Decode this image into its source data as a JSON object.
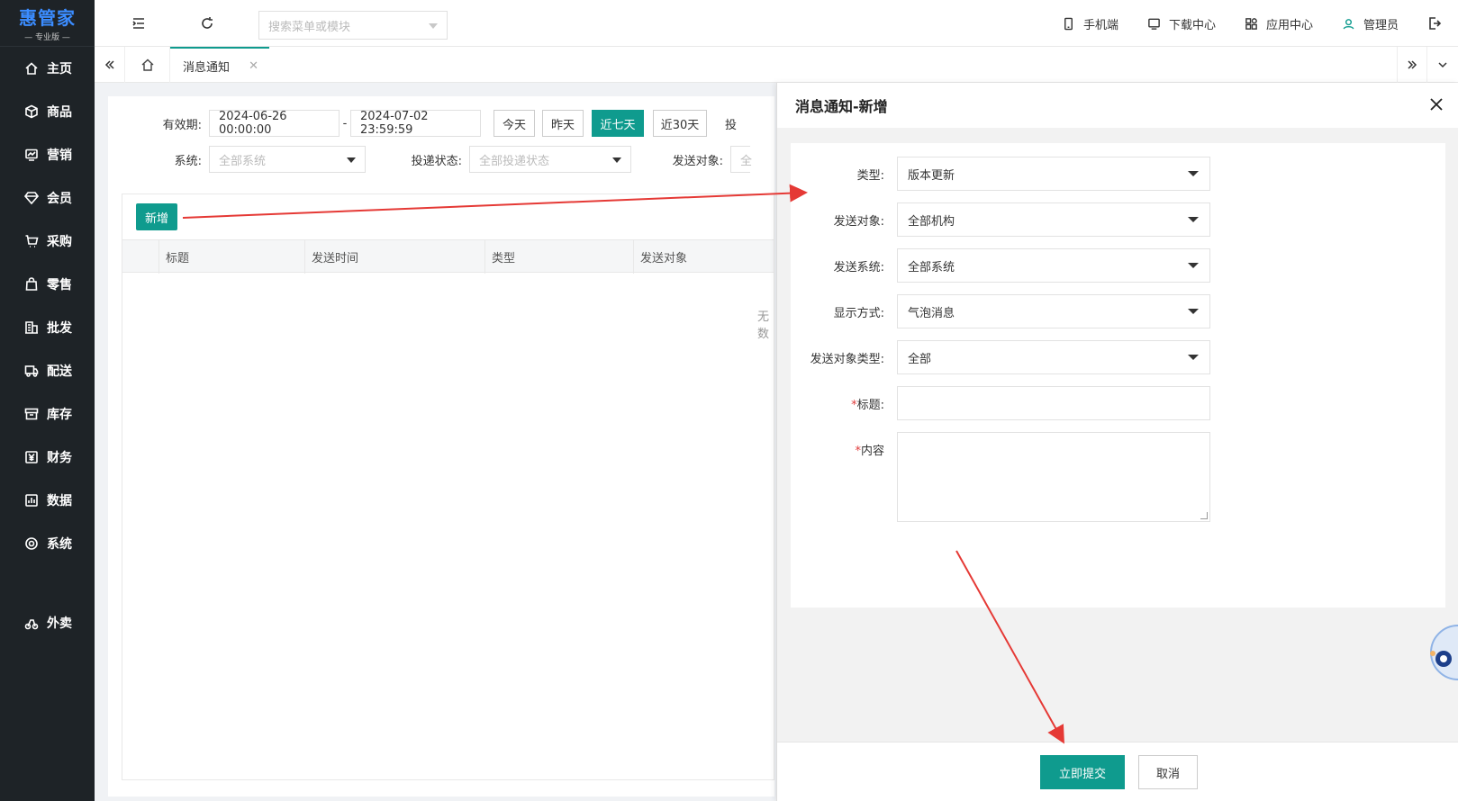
{
  "app": {
    "brand": "惠管家",
    "edition": "— 专业版 —"
  },
  "sidebar": {
    "items": [
      {
        "label": "主页",
        "icon": "home-icon"
      },
      {
        "label": "商品",
        "icon": "box-icon"
      },
      {
        "label": "营销",
        "icon": "chart-icon"
      },
      {
        "label": "会员",
        "icon": "diamond-icon"
      },
      {
        "label": "采购",
        "icon": "cart-icon"
      },
      {
        "label": "零售",
        "icon": "bag-icon"
      },
      {
        "label": "批发",
        "icon": "building-icon"
      },
      {
        "label": "配送",
        "icon": "truck-icon"
      },
      {
        "label": "库存",
        "icon": "archive-icon"
      },
      {
        "label": "财务",
        "icon": "yen-icon"
      },
      {
        "label": "数据",
        "icon": "bar-chart-icon"
      },
      {
        "label": "系统",
        "icon": "settings-icon"
      }
    ],
    "extra": {
      "label": "外卖",
      "icon": "delivery-icon"
    }
  },
  "topbar": {
    "search_placeholder": "搜索菜单或模块",
    "mobile": "手机端",
    "download": "下载中心",
    "apps": "应用中心",
    "user": "管理员"
  },
  "tabs": {
    "active": "消息通知"
  },
  "filters": {
    "validity_label": "有效期:",
    "start": "2024-06-26 00:00:00",
    "sep": "-",
    "end": "2024-07-02 23:59:59",
    "quick": [
      "今天",
      "昨天",
      "近七天",
      "近30天"
    ],
    "quick_active": "近七天",
    "truncated_label": "投",
    "system_label": "系统:",
    "system_placeholder": "全部系统",
    "status_label": "投递状态:",
    "status_placeholder": "全部投递状态",
    "target_label": "发送对象:",
    "target_placeholder": "全"
  },
  "grid": {
    "add_label": "新增",
    "columns": [
      "标题",
      "发送时间",
      "类型",
      "发送对象"
    ],
    "empty": "无数"
  },
  "drawer": {
    "title": "消息通知-新增",
    "fields": [
      {
        "label": "类型:",
        "value": "版本更新",
        "kind": "select"
      },
      {
        "label": "发送对象:",
        "value": "全部机构",
        "kind": "select"
      },
      {
        "label": "发送系统:",
        "value": "全部系统",
        "kind": "select"
      },
      {
        "label": "显示方式:",
        "value": "气泡消息",
        "kind": "select"
      },
      {
        "label": "发送对象类型:",
        "value": "全部",
        "kind": "select"
      }
    ],
    "title_field": {
      "required": "*",
      "label": "标题:"
    },
    "content_field": {
      "required": "*",
      "label": "内容"
    },
    "submit": "立即提交",
    "cancel": "取消"
  },
  "colors": {
    "accent": "#0f9b8e",
    "sidebar_bg": "#1e2327",
    "annotation": "#e53935"
  }
}
